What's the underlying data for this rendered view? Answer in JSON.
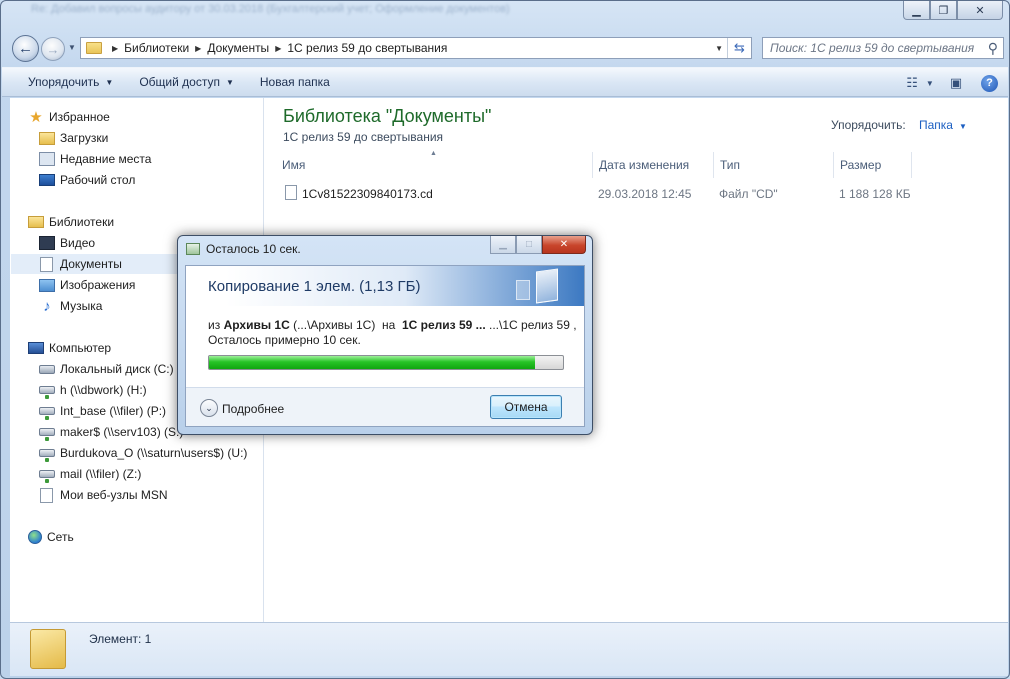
{
  "window": {
    "title": "Re: Добавил вопросы аудитору от 30.03.2018 (Бухгалтерский учет; Оформление документов)",
    "controls": {
      "minimize": "▁",
      "maximize": "❐",
      "close": "✕"
    }
  },
  "address": {
    "crumbs": [
      "Библиотеки",
      "Документы",
      "1С релиз 59 до свертывания"
    ]
  },
  "search": {
    "placeholder": "Поиск: 1С релиз 59 до свертывания"
  },
  "toolbar": {
    "organize": "Упорядочить",
    "share": "Общий доступ",
    "new_folder": "Новая папка"
  },
  "nav": {
    "favorites": {
      "label": "Избранное",
      "items": [
        "Загрузки",
        "Недавние места",
        "Рабочий стол"
      ]
    },
    "libraries": {
      "label": "Библиотеки",
      "items": [
        "Видео",
        "Документы",
        "Изображения",
        "Музыка"
      ]
    },
    "computer": {
      "label": "Компьютер",
      "items": [
        "Локальный диск (C:)",
        "h (\\\\dbwork) (H:)",
        "Int_base (\\\\filer) (P:)",
        "maker$ (\\\\serv103) (S:)",
        "Burdukova_O (\\\\saturn\\users$) (U:)",
        "mail (\\\\filer) (Z:)",
        "Мои веб-узлы MSN"
      ]
    },
    "network": {
      "label": "Сеть"
    }
  },
  "content": {
    "library_title": "Библиотека \"Документы\"",
    "library_subtitle": "1С релиз 59 до свертывания",
    "arrange_label": "Упорядочить:",
    "arrange_value": "Папка",
    "columns": {
      "name": "Имя",
      "date": "Дата изменения",
      "type": "Тип",
      "size": "Размер"
    },
    "files": [
      {
        "name": "1Cv81522309840173.cd",
        "date": "29.03.2018 12:45",
        "type": "Файл \"CD\"",
        "size": "1 188 128 КБ"
      }
    ]
  },
  "status": {
    "text": "Элемент: 1"
  },
  "dialog": {
    "title": "Осталось 10 сек.",
    "header": "Копирование 1 элем. (1,13 ГБ)",
    "line1": {
      "from_word": "из",
      "source": "Архивы 1С",
      "source_path": "(...\\Архивы 1С)",
      "to_word": "на",
      "dest": "1С релиз 59 ...",
      "dest_path": "...\\1С релиз 59 ,"
    },
    "remaining": "Осталось примерно 10 сек.",
    "progress_percent": 92,
    "details": "Подробнее",
    "cancel": "Отмена"
  }
}
